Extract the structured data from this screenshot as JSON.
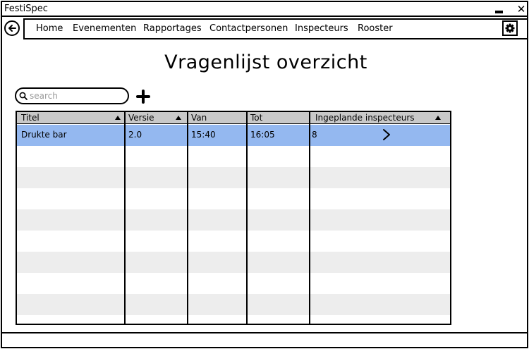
{
  "window": {
    "title": "FestiSpec"
  },
  "nav": {
    "items": [
      "Home",
      "Evenementen",
      "Rapportages",
      "Contactpersonen",
      "Inspecteurs",
      "Rooster"
    ]
  },
  "page": {
    "title": "Vragenlijst overzicht"
  },
  "search": {
    "placeholder": "search",
    "value": ""
  },
  "table": {
    "columns": [
      "Titel",
      "Versie",
      "Van",
      "Tot",
      "Ingeplande inspecteurs"
    ],
    "rows": [
      [
        "Drukte bar",
        "2.0",
        "15:40",
        "16:05",
        "8"
      ]
    ]
  },
  "colors": {
    "selected_row": "#94b8f0",
    "header": "#c9c9c9",
    "alt_row": "#ededed"
  },
  "icons": [
    "back-arrow-icon",
    "gear-icon",
    "search-icon",
    "plus-icon",
    "chevron-right-icon",
    "sort-ascending-icon",
    "minimize-icon",
    "close-icon"
  ]
}
